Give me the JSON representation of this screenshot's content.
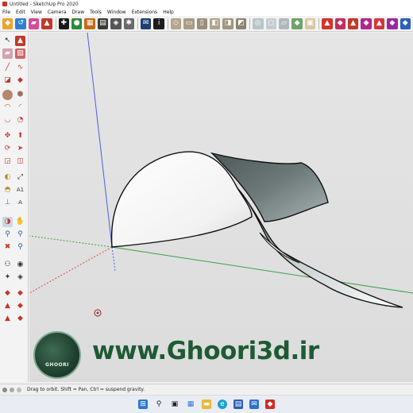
{
  "window": {
    "title": "Untitled - SketchUp Pro 2020"
  },
  "menu": {
    "items": [
      {
        "label": "File"
      },
      {
        "label": "Edit"
      },
      {
        "label": "View"
      },
      {
        "label": "Camera"
      },
      {
        "label": "Draw"
      },
      {
        "label": "Tools"
      },
      {
        "label": "Window"
      },
      {
        "label": "Extensions"
      },
      {
        "label": "Help"
      }
    ]
  },
  "toolbar": {
    "icons": [
      "getting-started-icon",
      "select-icon",
      "eraser-icon",
      "paint-bucket-icon",
      "add-location-icon",
      "model-info-icon",
      "components-icon",
      "materials-icon",
      "styles-icon",
      "settings-icon",
      "send-icon",
      "info-icon",
      "iso-view-icon",
      "top-view-icon",
      "front-view-icon",
      "right-view-icon",
      "back-view-icon",
      "left-view-icon",
      "xray-icon",
      "wireframe-icon",
      "hidden-line-icon",
      "shaded-icon",
      "textured-icon",
      "monochrome-icon",
      "sandbox-from-contours-icon",
      "sandbox-from-scratch-icon",
      "smoove-icon",
      "stamp-icon",
      "drape-icon",
      "add-detail-icon",
      "flip-edge-icon"
    ]
  },
  "palette": {
    "icons": [
      "select-icon",
      "paint-icon",
      "eraser-icon",
      "make-component-icon",
      "line-icon",
      "freehand-icon",
      "rectangle-icon",
      "rotated-rectangle-icon",
      "circle-icon",
      "polygon-icon",
      "arc-icon",
      "two-point-arc-icon",
      "three-point-arc-icon",
      "pie-icon",
      "move-icon",
      "push-pull-icon",
      "rotate-icon",
      "follow-me-icon",
      "scale-icon",
      "offset-icon",
      "tape-measure-icon",
      "dimension-icon",
      "protractor-icon",
      "text-icon",
      "axes-icon",
      "3d-text-icon",
      "orbit-icon",
      "pan-icon",
      "zoom-icon",
      "zoom-window-icon",
      "zoom-extents-icon",
      "previous-view-icon",
      "position-camera-icon",
      "look-around-icon",
      "walk-icon",
      "section-plane-icon",
      "display-sections-icon",
      "section-cuts-icon",
      "warehouse-icon",
      "extension-icon",
      "sandbox-icon",
      "layout-icon"
    ]
  },
  "watermark": {
    "url": "www.Ghoori3d.ir",
    "logo_text": "GHOORI"
  },
  "status": {
    "hint": "Drag to orbit. Shift = Pan, Ctrl = suspend gravity."
  },
  "taskbar": {
    "icons": [
      "windows-start-icon",
      "search-icon",
      "task-view-icon",
      "widgets-icon",
      "file-explorer-icon",
      "edge-icon",
      "store-icon",
      "mail-icon",
      "sketchup-icon"
    ]
  }
}
